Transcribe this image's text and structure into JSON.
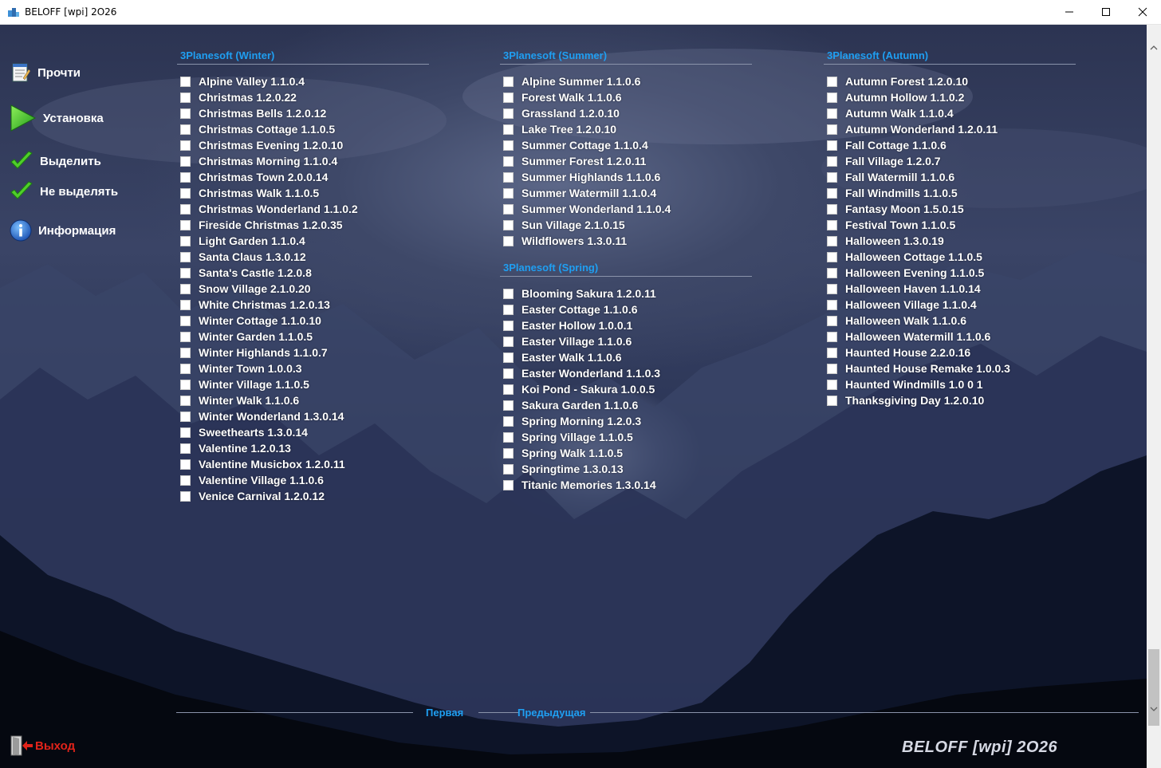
{
  "window": {
    "title": "BELOFF [wpi] 2O26"
  },
  "menu": {
    "read": "Прочти",
    "install": "Установка",
    "select_all": "Выделить",
    "deselect_all": "Не выделять",
    "info": "Информация",
    "exit": "Выход"
  },
  "groups": {
    "winter": {
      "title": "3Planesoft (Winter)",
      "items": [
        "Alpine Valley 1.1.0.4",
        "Christmas 1.2.0.22",
        "Christmas Bells 1.2.0.12",
        "Christmas Cottage 1.1.0.5",
        "Christmas Evening 1.2.0.10",
        "Christmas Morning 1.1.0.4",
        "Christmas Town 2.0.0.14",
        "Christmas Walk 1.1.0.5",
        "Christmas Wonderland 1.1.0.2",
        "Fireside Christmas 1.2.0.35",
        "Light Garden 1.1.0.4",
        "Santa Claus 1.3.0.12",
        "Santa's Castle 1.2.0.8",
        "Snow Village 2.1.0.20",
        "White Christmas 1.2.0.13",
        "Winter Cottage 1.1.0.10",
        "Winter Garden 1.1.0.5",
        "Winter Highlands 1.1.0.7",
        "Winter Town 1.0.0.3",
        "Winter Village 1.1.0.5",
        "Winter Walk 1.1.0.6",
        "Winter Wonderland 1.3.0.14",
        "Sweethearts 1.3.0.14",
        "Valentine 1.2.0.13",
        "Valentine Musicbox 1.2.0.11",
        "Valentine Village 1.1.0.6",
        "Venice Carnival 1.2.0.12"
      ]
    },
    "summer": {
      "title": "3Planesoft (Summer)",
      "items": [
        "Alpine Summer 1.1.0.6",
        "Forest Walk 1.1.0.6",
        "Grassland 1.2.0.10",
        "Lake Tree 1.2.0.10",
        "Summer Cottage 1.1.0.4",
        "Summer Forest 1.2.0.11",
        "Summer Highlands 1.1.0.6",
        "Summer Watermill 1.1.0.4",
        "Summer Wonderland 1.1.0.4",
        "Sun Village 2.1.0.15",
        "Wildflowers 1.3.0.11"
      ]
    },
    "spring": {
      "title": "3Planesoft (Spring)",
      "items": [
        "Blooming Sakura 1.2.0.11",
        "Easter Cottage 1.1.0.6",
        "Easter Hollow 1.0.0.1",
        "Easter Village 1.1.0.6",
        "Easter Walk 1.1.0.6",
        "Easter Wonderland 1.1.0.3",
        "Koi Pond - Sakura 1.0.0.5",
        "Sakura Garden 1.1.0.6",
        "Spring Morning 1.2.0.3",
        "Spring Village 1.1.0.5",
        "Spring Walk 1.1.0.5",
        "Springtime 1.3.0.13",
        "Titanic Memories 1.3.0.14"
      ]
    },
    "autumn": {
      "title": "3Planesoft (Autumn)",
      "items": [
        "Autumn Forest 1.2.0.10",
        "Autumn Hollow 1.1.0.2",
        "Autumn Walk 1.1.0.4",
        "Autumn Wonderland 1.2.0.11",
        "Fall Cottage 1.1.0.6",
        "Fall Village 1.2.0.7",
        "Fall Watermill 1.1.0.6",
        "Fall Windmills 1.1.0.5",
        "Fantasy Moon 1.5.0.15",
        "Festival Town 1.1.0.5",
        "Halloween 1.3.0.19",
        "Halloween Cottage 1.1.0.5",
        "Halloween Evening 1.1.0.5",
        "Halloween Haven 1.1.0.14",
        "Halloween Village 1.1.0.4",
        "Halloween Walk 1.1.0.6",
        "Halloween Watermill 1.1.0.6",
        "Haunted House 2.2.0.16",
        "Haunted House Remake 1.0.0.3",
        "Haunted Windmills 1.0 0 1",
        "Thanksgiving Day 1.2.0.10"
      ]
    }
  },
  "nav": {
    "first": "Первая",
    "previous": "Предыдущая"
  },
  "brand": "BELOFF [wpi] 2O26",
  "colors": {
    "accent": "#1f9ff2",
    "exit": "#e2231a",
    "text": "#ffffff"
  }
}
